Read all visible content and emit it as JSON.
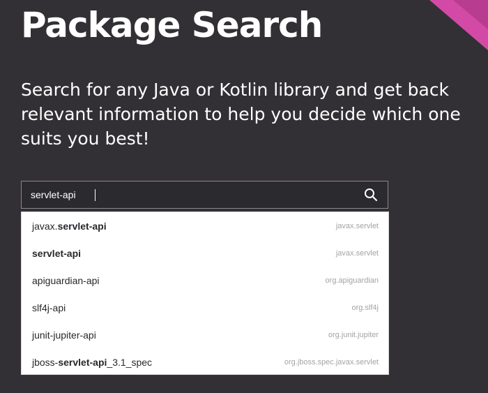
{
  "header": {
    "title": "Package Search",
    "subtitle": "Search for any Java or Kotlin library and get back relevant information to help you decide which one suits you best!"
  },
  "search": {
    "value": "servlet-api",
    "icon": "search-icon"
  },
  "colors": {
    "background": "#323035",
    "accent": "#d34aa6",
    "dropdown_bg": "#ffffff",
    "muted_text": "#a3a3a6"
  },
  "suggestions": [
    {
      "name_prefix": "javax.",
      "name_match": "servlet-api",
      "name_suffix": "",
      "group": "javax.servlet"
    },
    {
      "name_prefix": "",
      "name_match": "servlet-api",
      "name_suffix": "",
      "group": "javax.servlet"
    },
    {
      "name_prefix": "apiguardian-api",
      "name_match": "",
      "name_suffix": "",
      "group": "org.apiguardian"
    },
    {
      "name_prefix": "slf4j-api",
      "name_match": "",
      "name_suffix": "",
      "group": "org.slf4j"
    },
    {
      "name_prefix": "junit-jupiter-api",
      "name_match": "",
      "name_suffix": "",
      "group": "org.junit.jupiter"
    },
    {
      "name_prefix": "jboss-",
      "name_match": "servlet-api",
      "name_suffix": "_3.1_spec",
      "group": "org.jboss.spec.javax.servlet"
    }
  ]
}
